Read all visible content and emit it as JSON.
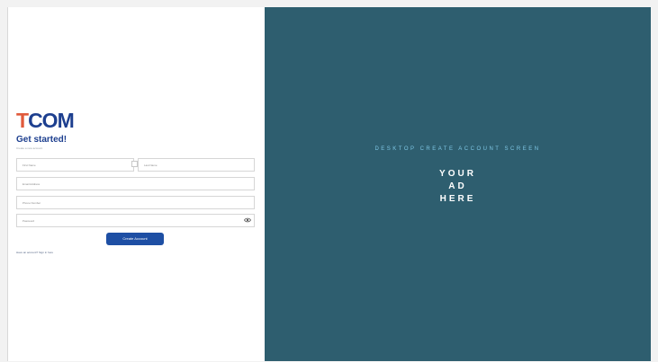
{
  "brand": {
    "logo_prefix": "T",
    "logo_rest": "COM"
  },
  "form": {
    "title": "Get started!",
    "subtitle": "Create a new account",
    "first_name_placeholder": "First Name",
    "last_name_placeholder": "Last Name",
    "email_placeholder": "Email Address",
    "phone_placeholder": "Phone Number",
    "password_placeholder": "Password",
    "submit_label": "Create Account",
    "login_link": "Have an account? Sign in here"
  },
  "ad": {
    "caption": "DESKTOP CREATE ACCOUNT SCREEN",
    "line1": "YOUR",
    "line2": "AD",
    "line3": "HERE"
  },
  "colors": {
    "ad_background": "#2e5e6f",
    "brand_blue": "#1d3f8f",
    "button": "#1e4fa4",
    "accent": "#e05a3c"
  },
  "icons": {
    "password_toggle": "eye-icon"
  }
}
